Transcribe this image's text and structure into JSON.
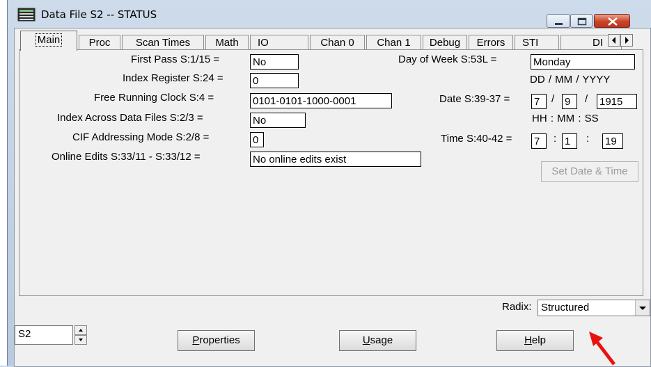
{
  "window": {
    "title": "Data File S2  --  STATUS"
  },
  "tabs": [
    "Main",
    "Proc",
    "Scan Times",
    "Math",
    "IO",
    "Chan 0",
    "Chan 1",
    "Debug",
    "Errors",
    "STI",
    "DI"
  ],
  "fields": {
    "first_pass": {
      "label": "First Pass S:1/15 =",
      "value": "No"
    },
    "index_register": {
      "label": "Index Register S:24 =",
      "value": "0"
    },
    "free_running_clock": {
      "label": "Free Running Clock S:4 =",
      "value": "0101-0101-1000-0001"
    },
    "index_across": {
      "label": "Index Across Data Files S:2/3 =",
      "value": "No"
    },
    "cif_addressing": {
      "label": "CIF Addressing Mode S:2/8 =",
      "value": "0"
    },
    "online_edits": {
      "label": "Online Edits S:33/11 - S:33/12 =",
      "value": "No online edits exist"
    },
    "day_of_week": {
      "label": "Day of Week S:53L =",
      "value": "Monday"
    },
    "date": {
      "header": "DD  /  MM  /  YYYY",
      "label": "Date S:39-37 =",
      "dd": "7",
      "mm": "9",
      "yyyy": "1915",
      "sep": "/"
    },
    "time": {
      "header": "HH  :  MM  :  SS",
      "label": "Time S:40-42 =",
      "hh": "7",
      "mm": "1",
      "ss": "19",
      "sep": ":"
    }
  },
  "buttons": {
    "set_date_time": "Set Date & Time",
    "properties": {
      "underline": "P",
      "rest": "roperties"
    },
    "usage": {
      "underline": "U",
      "rest": "sage"
    },
    "help": {
      "underline": "H",
      "rest": "elp"
    }
  },
  "radix": {
    "label": "Radix:",
    "value": "Structured"
  },
  "file_selector": {
    "value": "S2"
  },
  "colors": {
    "close_button": "#c9442a",
    "annotation_arrow": "#e8130f"
  }
}
